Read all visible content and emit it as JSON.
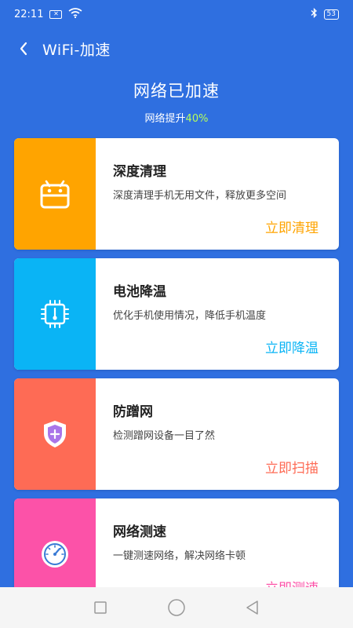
{
  "status_bar": {
    "time": "22:11",
    "notification_glyph": "✕",
    "battery": "53",
    "icons": [
      "wifi-icon",
      "bluetooth-icon",
      "battery-icon"
    ]
  },
  "app_bar": {
    "title": "WiFi-加速"
  },
  "hero": {
    "title": "网络已加速",
    "subtitle_prefix": "网络提升",
    "percent": "40%"
  },
  "cards": [
    {
      "title": "深度清理",
      "desc": "深度清理手机无用文件，释放更多空间",
      "action": "立即清理",
      "color": "#ffa400",
      "icon": "android-icon"
    },
    {
      "title": "电池降温",
      "desc": "优化手机使用情况，降低手机温度",
      "action": "立即降温",
      "color": "#0ab4f5",
      "icon": "chip-thermometer-icon"
    },
    {
      "title": "防蹭网",
      "desc": "检测蹭网设备一目了然",
      "action": "立即扫描",
      "color": "#fe6b55",
      "icon": "shield-icon"
    },
    {
      "title": "网络测速",
      "desc": "一键测速网络，解决网络卡顿",
      "action": "立即测速",
      "color": "#fc52a8",
      "icon": "speedometer-icon"
    }
  ],
  "nav_bar": {
    "icons": [
      "recent-apps-icon",
      "home-icon",
      "back-triangle-icon"
    ]
  }
}
